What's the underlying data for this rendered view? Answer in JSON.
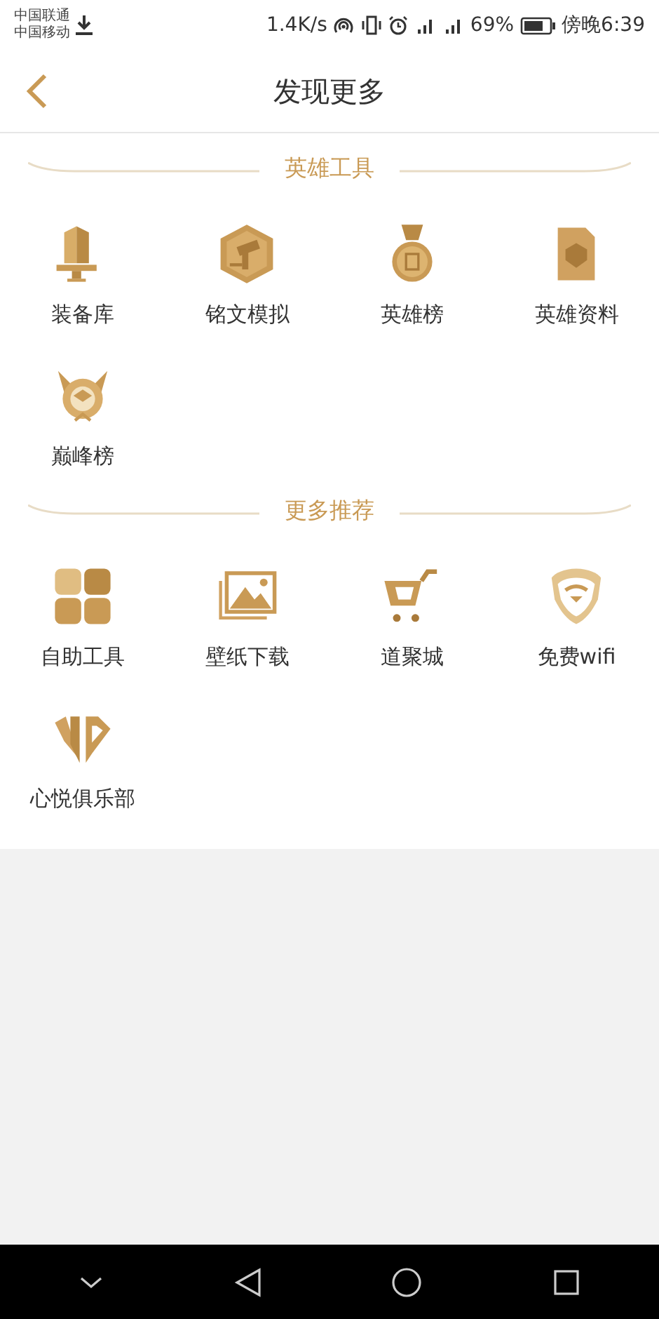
{
  "status_bar": {
    "carriers": [
      "中国联通",
      "中国移动"
    ],
    "speed": "1.4K/s",
    "battery": "69%",
    "time": "傍晚6:39"
  },
  "header": {
    "title": "发现更多"
  },
  "sections": [
    {
      "title": "英雄工具",
      "items": [
        {
          "label": "装备库"
        },
        {
          "label": "铭文模拟"
        },
        {
          "label": "英雄榜"
        },
        {
          "label": "英雄资料"
        },
        {
          "label": "巅峰榜"
        }
      ]
    },
    {
      "title": "更多推荐",
      "items": [
        {
          "label": "自助工具"
        },
        {
          "label": "壁纸下载"
        },
        {
          "label": "道聚城"
        },
        {
          "label": "免费wifi"
        },
        {
          "label": "心悦俱乐部"
        }
      ]
    }
  ]
}
